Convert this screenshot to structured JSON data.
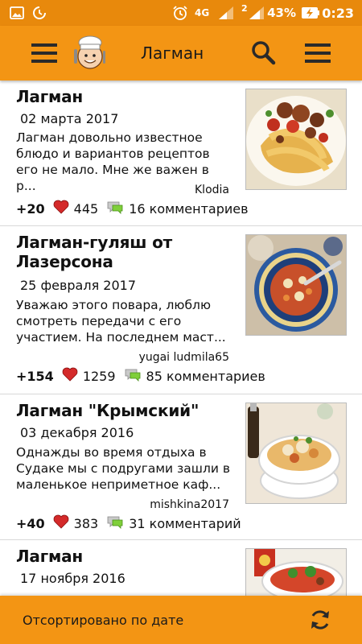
{
  "status_bar": {
    "battery_percent": "43%",
    "time": "0:23",
    "network_label": "4G",
    "sim_label": "2"
  },
  "app_bar": {
    "title": "Лагман",
    "icons": [
      "menu-icon",
      "chef-logo-icon",
      "search-icon",
      "overflow-menu-icon"
    ]
  },
  "recipes": [
    {
      "title": "Лагман",
      "date": "02 марта 2017",
      "description": "Лагман довольно известное блюдо и вариантов рецептов его не мало. Мне же важен в р...",
      "author": "Klodia",
      "score": "+20",
      "likes": "445",
      "comments": "16 комментариев"
    },
    {
      "title": "Лагман-гуляш от Лазерсона",
      "date": "25 февраля 2017",
      "description": "Уважаю этого повара, люблю смотреть передачи с его участием. На последнем маст...",
      "author": "yugai ludmila65",
      "score": "+154",
      "likes": "1259",
      "comments": "85 комментариев"
    },
    {
      "title": "Лагман \"Крымский\"",
      "date": "03 декабря 2016",
      "description": "Однажды во время отдыха в Судаке мы с подругами зашли в маленькое неприметное каф...",
      "author": "mishkina2017",
      "score": "+40",
      "likes": "383",
      "comments": "31 комментарий"
    },
    {
      "title": "Лагман",
      "date": "17 ноября 2016",
      "description": "",
      "author": "",
      "score": "",
      "likes": "",
      "comments": ""
    }
  ],
  "bottom_bar": {
    "sort_label": "Отсортировано по дате",
    "refresh_icon": "refresh-icon"
  },
  "colors": {
    "accent": "#f39514",
    "status_bar": "#e8890c",
    "heart": "#d42a2a"
  }
}
